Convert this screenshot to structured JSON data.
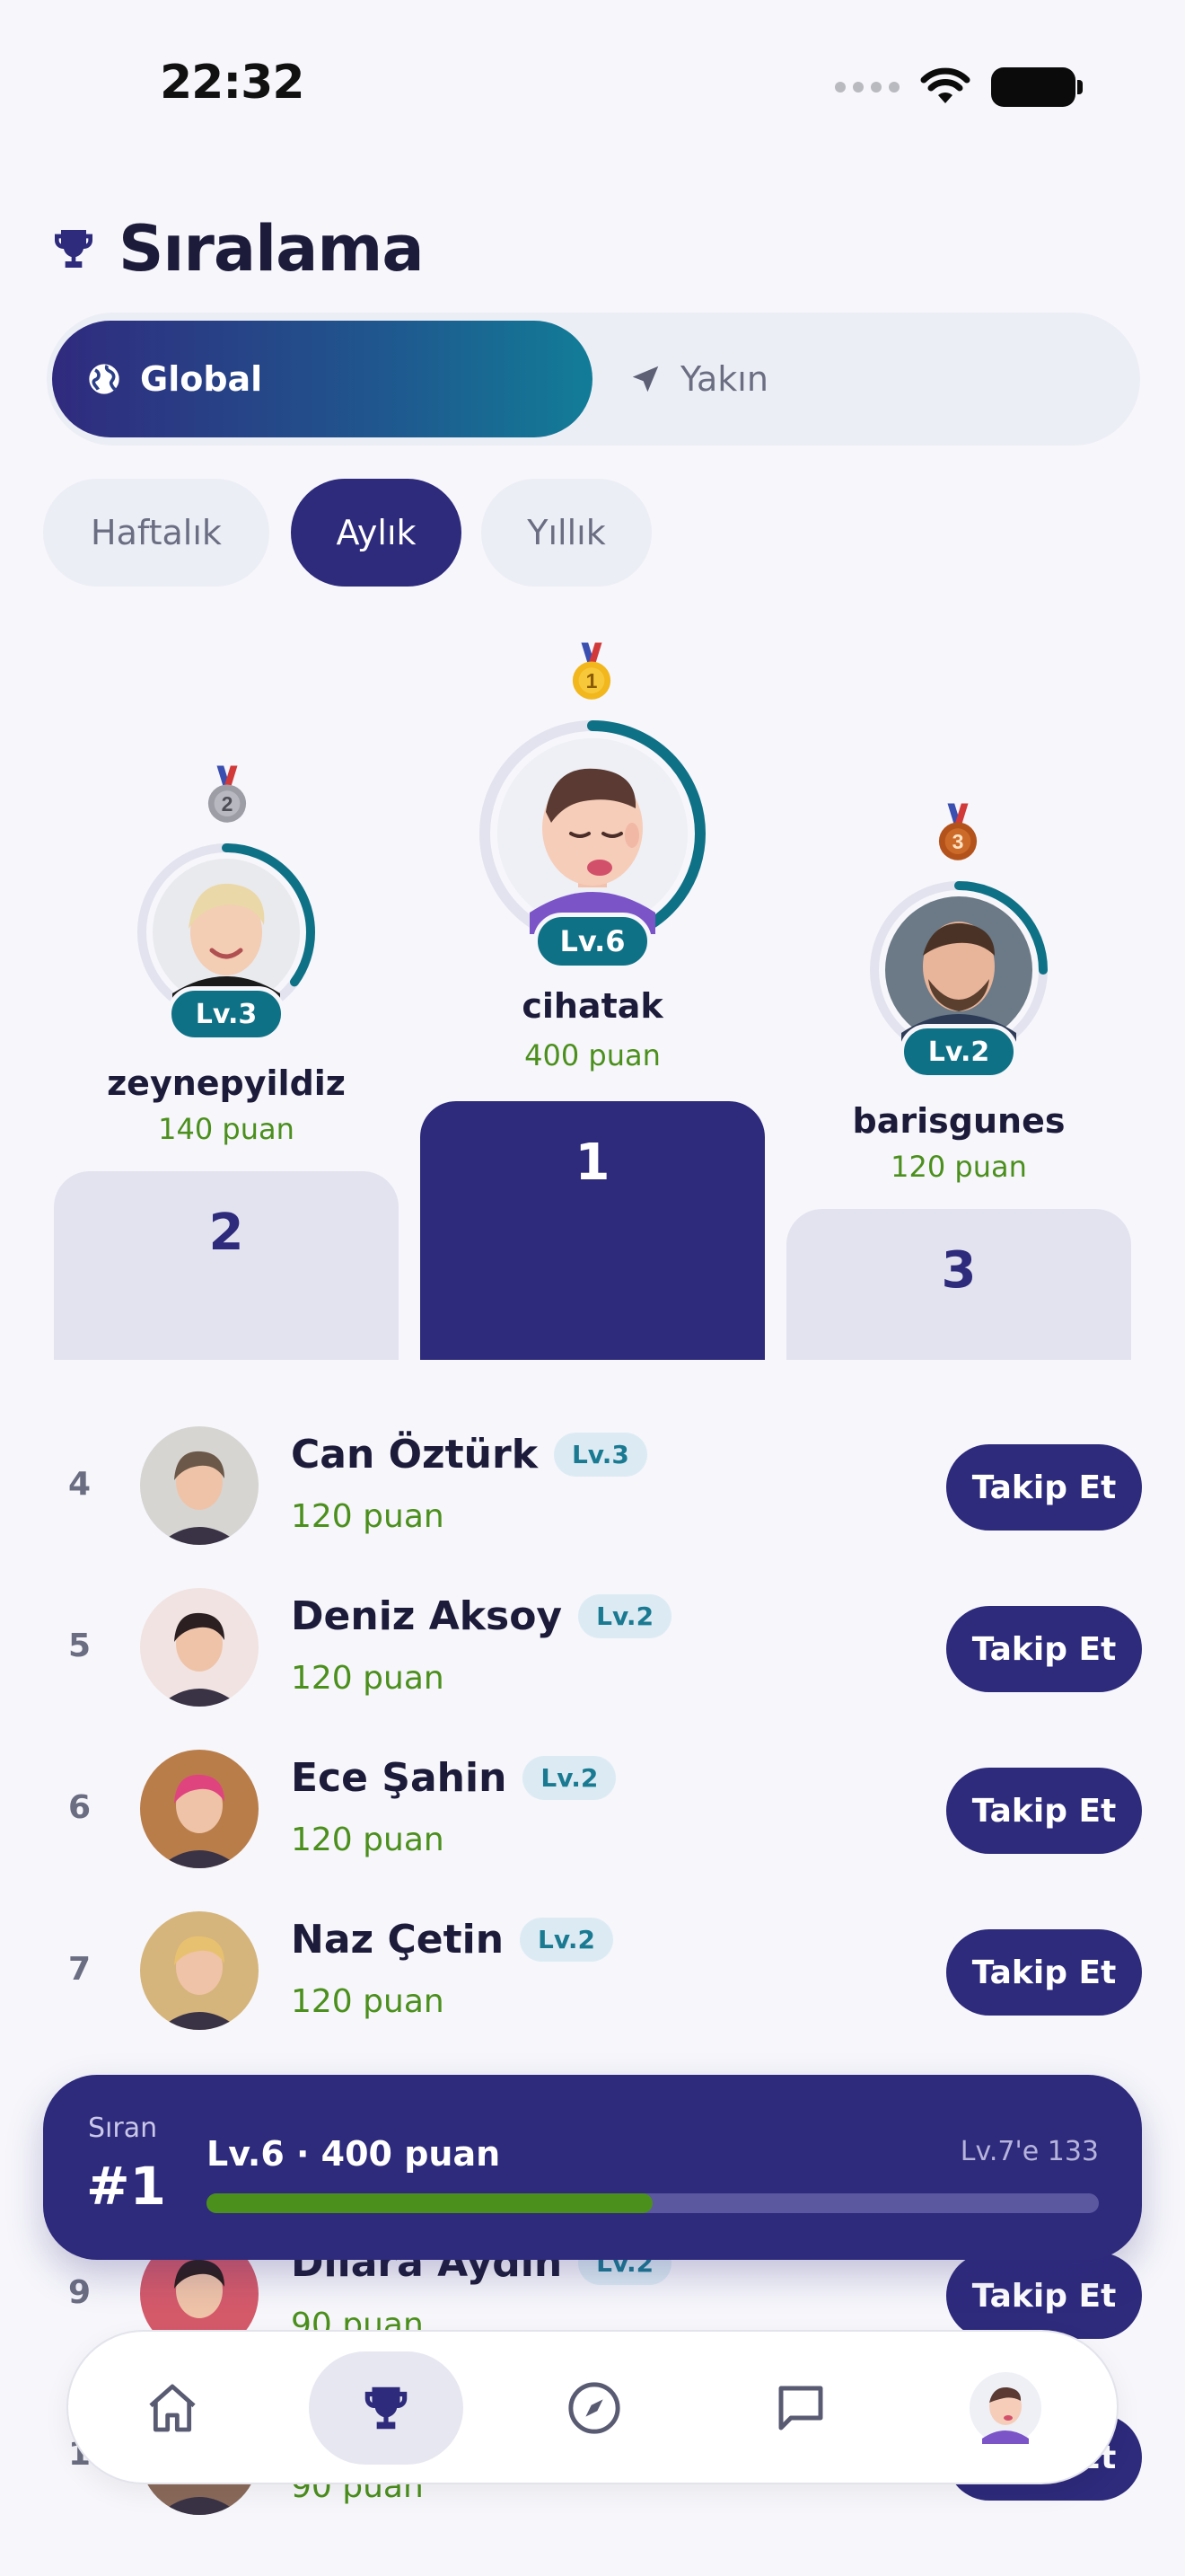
{
  "status_bar": {
    "time": "22:32"
  },
  "header": {
    "title": "Sıralama"
  },
  "scope_tabs": [
    {
      "label": "Global",
      "active": true
    },
    {
      "label": "Yakın",
      "active": false
    }
  ],
  "period_tabs": [
    {
      "label": "Haftalık",
      "active": false
    },
    {
      "label": "Aylık",
      "active": true
    },
    {
      "label": "Yıllık",
      "active": false
    }
  ],
  "podium": {
    "first": {
      "place": "1",
      "name": "cihatak",
      "points": "400 puan",
      "level": "Lv.6",
      "level_progress": 0.45
    },
    "second": {
      "place": "2",
      "name": "zeynepyildiz",
      "points": "140 puan",
      "level": "Lv.3",
      "level_progress": 0.35
    },
    "third": {
      "place": "3",
      "name": "barisgunes",
      "points": "120 puan",
      "level": "Lv.2",
      "level_progress": 0.25
    }
  },
  "leaderboard": [
    {
      "rank": "4",
      "name": "Can Öztürk",
      "level": "Lv.3",
      "points": "120 puan",
      "action": "Takip Et"
    },
    {
      "rank": "5",
      "name": "Deniz Aksoy",
      "level": "Lv.2",
      "points": "120 puan",
      "action": "Takip Et"
    },
    {
      "rank": "6",
      "name": "Ece Şahin",
      "level": "Lv.2",
      "points": "120 puan",
      "action": "Takip Et"
    },
    {
      "rank": "7",
      "name": "Naz Çetin",
      "level": "Lv.2",
      "points": "120 puan",
      "action": "Takip Et"
    },
    {
      "rank": "9",
      "name": "Dilara Aydın",
      "level": "Lv.2",
      "points": "90 puan",
      "action": "Takip Et"
    },
    {
      "rank": "10",
      "name": "",
      "level": "",
      "points": "90 puan",
      "action": "Takip Et"
    }
  ],
  "my_rank": {
    "label": "Sıran",
    "rank": "#1",
    "summary": "Lv.6 · 400 puan",
    "next_level": "Lv.7'e 133",
    "progress": 0.5
  },
  "tab_bar": [
    {
      "icon": "home-icon",
      "active": false
    },
    {
      "icon": "trophy-icon",
      "active": true
    },
    {
      "icon": "compass-icon",
      "active": false
    },
    {
      "icon": "chat-icon",
      "active": false
    },
    {
      "icon": "profile-avatar",
      "active": false
    }
  ],
  "colors": {
    "primary": "#2e2a7c",
    "teal": "#0f7186",
    "points_green": "#4b8f1c",
    "background": "#f6f6fb"
  }
}
